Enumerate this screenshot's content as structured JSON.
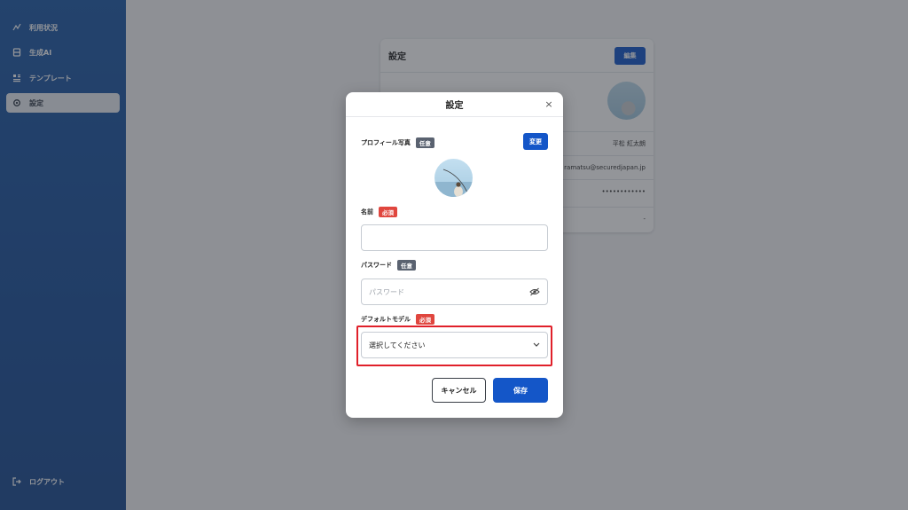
{
  "sidebar": {
    "items": [
      {
        "label": "利用状況",
        "icon": "chart-icon"
      },
      {
        "label": "生成AI",
        "icon": "ai-icon"
      },
      {
        "label": "テンプレート",
        "icon": "template-icon"
      },
      {
        "label": "設定",
        "icon": "gear-icon"
      }
    ],
    "logout_label": "ログアウト"
  },
  "background_page": {
    "title": "設定",
    "edit_label": "編集",
    "rows": [
      "平松 紅太朗",
      "ramatsu@securedjapan.jp",
      "••••••••••••",
      "-"
    ]
  },
  "modal": {
    "title": "設定",
    "close_symbol": "×",
    "profile_photo": {
      "label": "プロフィール写真",
      "badge": "任意",
      "change_label": "変更"
    },
    "name": {
      "label": "名前",
      "badge": "必須",
      "value": ""
    },
    "password": {
      "label": "パスワード",
      "badge": "任意",
      "placeholder": "パスワード"
    },
    "default_model": {
      "label": "デフォルトモデル",
      "badge": "必須",
      "value": "選択してください"
    },
    "cancel_label": "キャンセル",
    "save_label": "保存"
  },
  "colors": {
    "primary": "#1456c8",
    "required_badge": "#e0463e",
    "optional_badge": "#5a6270",
    "highlight": "#e0202a"
  }
}
